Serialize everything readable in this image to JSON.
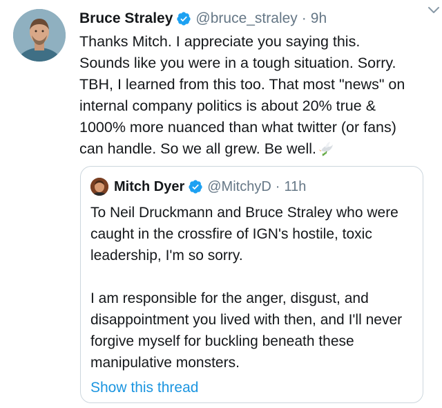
{
  "tweet": {
    "author_name": "Bruce Straley",
    "handle": "@bruce_straley",
    "separator": "·",
    "time": "9h",
    "verified_icon": "verified-badge-icon",
    "menu_icon": "chevron-down-icon",
    "text": "Thanks Mitch. I appreciate you saying this.\nSounds like you were in a tough situation. Sorry.\nTBH, I learned from this too. That most \"news\" on\ninternal company politics is about 20% true &\n1000% more nuanced than what twitter (or fans)\ncan handle. So we all grew. Be well.",
    "emoji": "dove-icon"
  },
  "quoted": {
    "author_name": "Mitch Dyer",
    "handle": "@MitchyD",
    "separator": "·",
    "time": "11h",
    "paragraph_1": "To Neil Druckmann and Bruce Straley who were caught in the crossfire of IGN's hostile, toxic leadership, I'm so sorry.",
    "paragraph_2": "I am responsible for the anger, disgust, and disappointment you lived with then, and I'll never forgive myself for buckling beneath these manipulative monsters.",
    "show_thread": "Show this thread"
  },
  "colors": {
    "text": "#14171a",
    "secondary": "#657786",
    "link": "#1b95e0",
    "verified": "#1da1f2",
    "border": "#ccd6dd"
  }
}
